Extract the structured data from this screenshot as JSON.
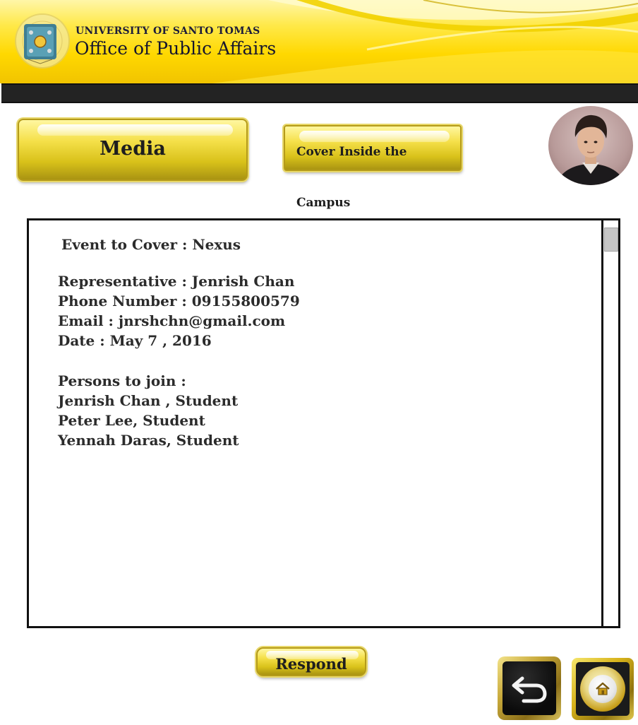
{
  "header": {
    "university": "UNIVERSITY OF SANTO TOMAS",
    "office": "Office of Public Affairs",
    "logo_icon": "ust-seal-icon"
  },
  "toolbar": {
    "media_label": "Media",
    "category_label": "Cover Inside the Campus"
  },
  "user": {
    "avatar_icon": "user-avatar"
  },
  "request": {
    "event": "Event to Cover : Nexus",
    "representative": "Representative : Jenrish Chan",
    "phone": "Phone Number : 09155800579",
    "email": "Email : jnrshchn@gmail.com",
    "date": "Date : May 7 , 2016",
    "persons_heading": "Persons to join :",
    "persons": [
      "Jenrish Chan , Student",
      "Peter Lee, Student",
      "Yennah Daras, Student"
    ]
  },
  "actions": {
    "respond_label": "Respond"
  },
  "nav": {
    "back_icon": "back-arrow-icon",
    "home_icon": "home-icon"
  },
  "colors": {
    "gold": "#e6cf2a",
    "banner": "#ffd800",
    "bar": "#232323"
  }
}
